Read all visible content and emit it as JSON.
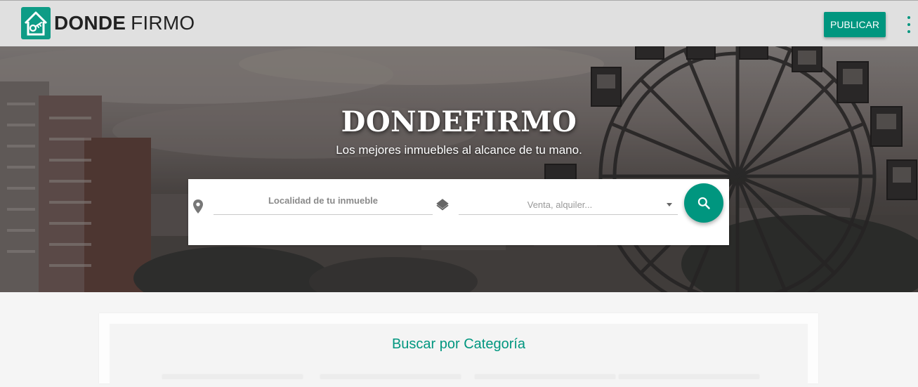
{
  "header": {
    "brand_bold": "DONDE",
    "brand_light": "FIRMO",
    "publish_label": "PUBLICAR",
    "menu_icon": "more-vert-icon"
  },
  "hero": {
    "title": "DONDEFIRMO",
    "subtitle": "Los mejores inmuebles al alcance de tu mano."
  },
  "search": {
    "location_placeholder": "Localidad de tu inmueble",
    "type_value": "Venta, alquiler...",
    "icons": [
      "location-pin-icon",
      "layers-icon",
      "search-icon",
      "dropdown-caret-icon"
    ]
  },
  "categories": {
    "title": "Buscar por Categoría"
  },
  "colors": {
    "accent": "#00967f",
    "header_bg": "#e0e0e0",
    "page_bg": "#f5f5f5"
  }
}
